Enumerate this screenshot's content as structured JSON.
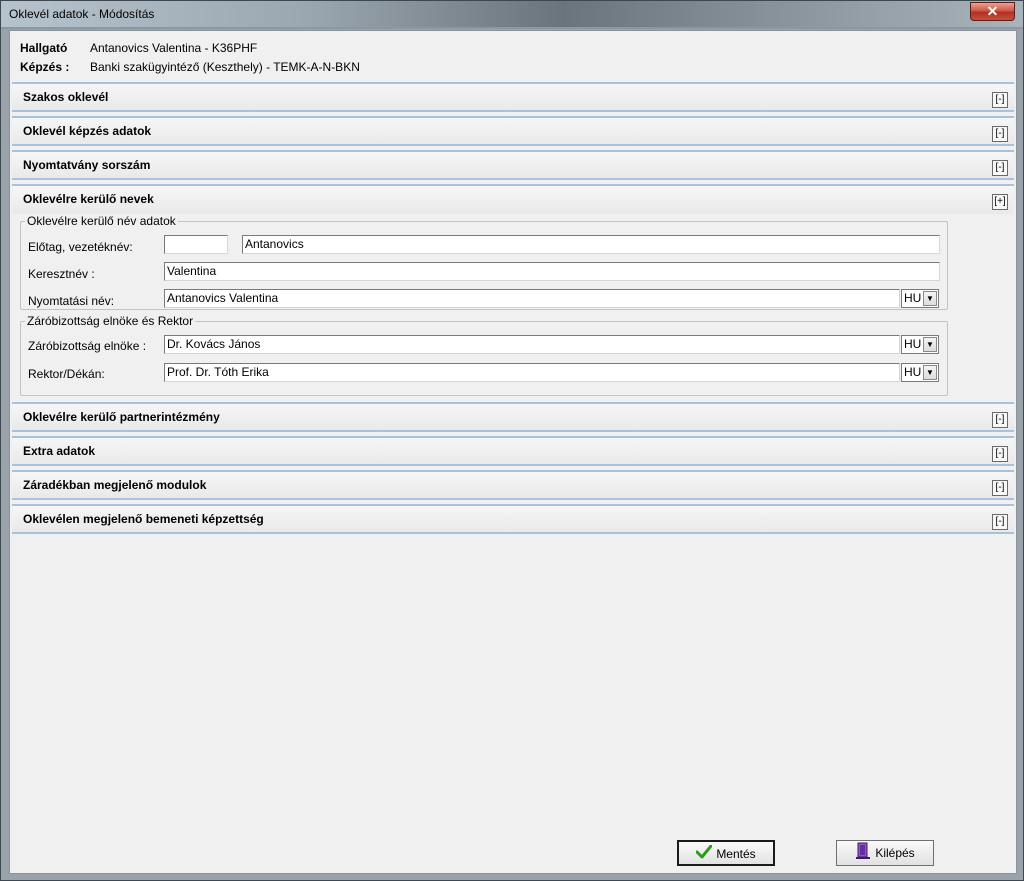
{
  "window": {
    "title": "Oklevél adatok - Módosítás",
    "close_glyph": "✕"
  },
  "header": {
    "student_label": "Hallgató",
    "student_value": "Antanovics Valentina - K36PHF",
    "training_label": "Képzés :",
    "training_value": "Banki szakügyintéző (Keszthely) - TEMK-A-N-BKN"
  },
  "sections": [
    {
      "title": "Szakos oklevél",
      "toggle": "[-]"
    },
    {
      "title": "Oklevél képzés adatok",
      "toggle": "[-]"
    },
    {
      "title": "Nyomtatvány sorszám",
      "toggle": "[-]"
    },
    {
      "title": "Oklevélre kerülő nevek",
      "toggle": "[+]"
    },
    {
      "title": "Oklevélre kerülő partnerintézmény",
      "toggle": "[-]"
    },
    {
      "title": "Extra adatok",
      "toggle": "[-]"
    },
    {
      "title": "Záradékban megjelenő modulok",
      "toggle": "[-]"
    },
    {
      "title": "Oklevélen megjelenő bemeneti képzettség",
      "toggle": "[-]"
    }
  ],
  "names": {
    "group1_legend": "Oklevélre kerülő név adatok",
    "prefix_label": "Előtag, vezetéknév:",
    "prefix_value": "",
    "surname_value": "Antanovics",
    "firstname_label": "Keresztnév :",
    "firstname_value": "Valentina",
    "print_label": "Nyomtatási név:",
    "print_value": "Antanovics Valentina",
    "print_lang": "HU",
    "group2_legend": "Záróbizottság elnöke és Rektor",
    "chair_label": "Záróbizottság elnöke :",
    "chair_value": "Dr. Kovács János",
    "chair_lang": "HU",
    "rector_label": "Rektor/Dékán:",
    "rector_value": "Prof. Dr. Tóth Erika",
    "rector_lang": "HU"
  },
  "buttons": {
    "save_label": "Mentés",
    "exit_label": "Kilépés"
  },
  "icons": {
    "save": "check-icon",
    "exit": "exit-door-icon",
    "dropdown": "chevron-down-icon"
  },
  "colors": {
    "section_border": "#a9c1dd",
    "save_check": "#2e9a1e",
    "exit_icon": "#6a2ba0"
  }
}
